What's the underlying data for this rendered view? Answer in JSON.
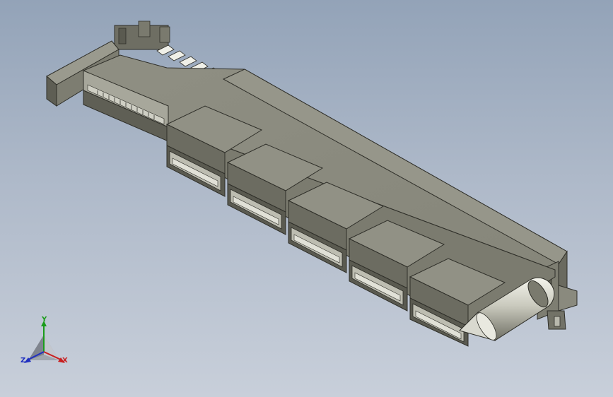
{
  "viewport": {
    "background_top": "#93a3b8",
    "background_bottom": "#c8cfda",
    "model_color": "#8e8e82"
  },
  "connector": {
    "port_count": 5,
    "header_pin_count": 5
  },
  "triad": {
    "y_label": "Y",
    "x_label": "X",
    "z_label": "Z",
    "y_color": "#1a9c1a",
    "x_color": "#c82020",
    "z_color": "#2030c0"
  }
}
